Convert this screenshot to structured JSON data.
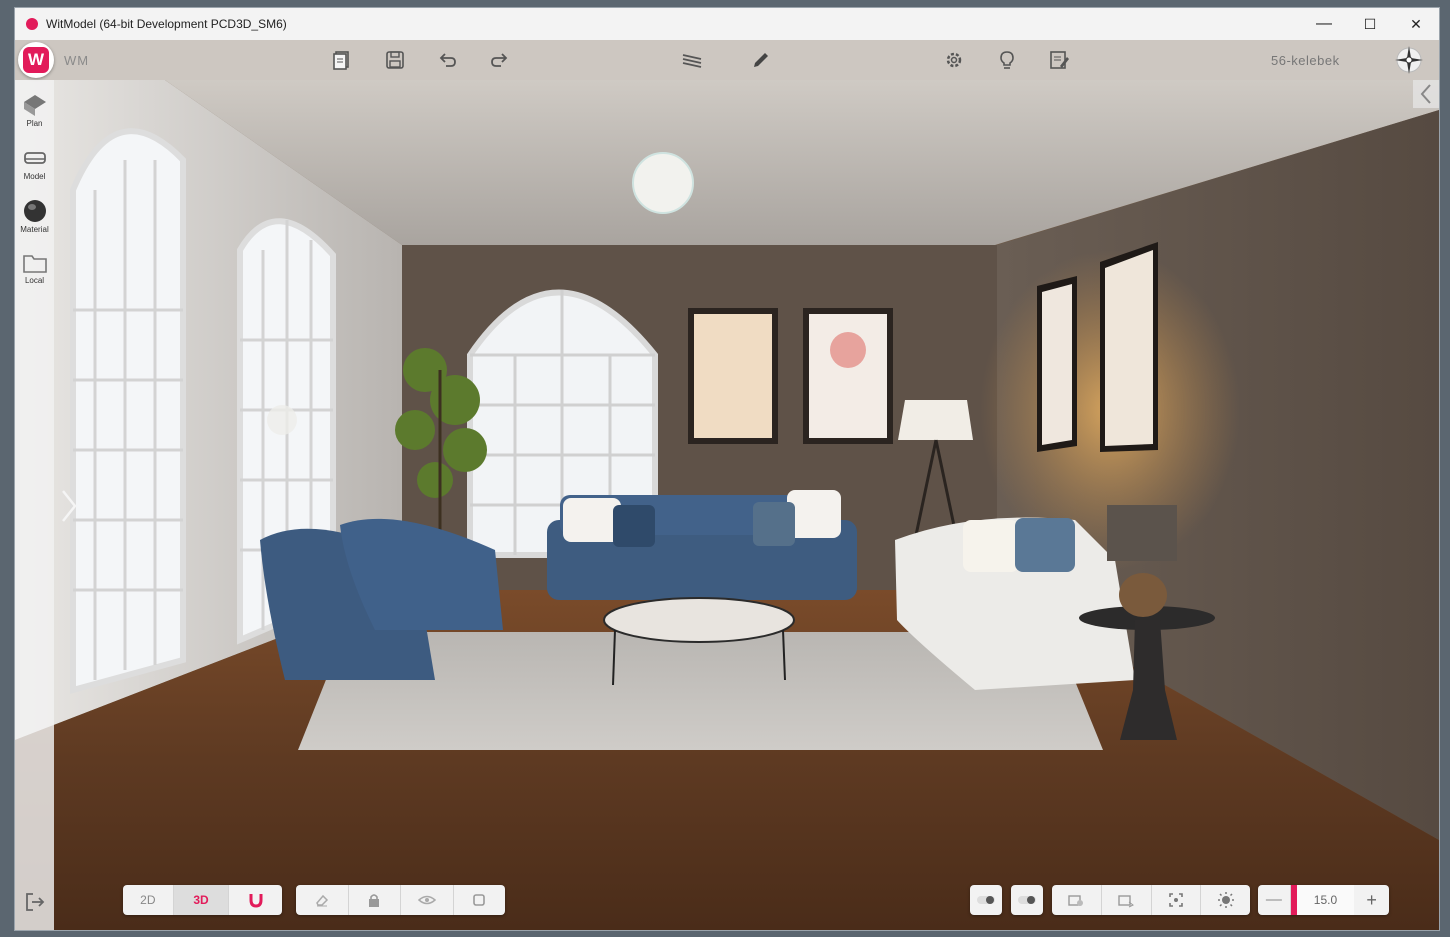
{
  "window": {
    "title": "WitModel (64-bit Development PCD3D_SM6)",
    "minimize": "—",
    "maximize": "☐",
    "close": "✕"
  },
  "toolbar": {
    "logo_letter": "W",
    "app_short": "WM",
    "project_name": "56-kelebek",
    "icons": [
      "pages-icon",
      "save-icon",
      "undo-icon",
      "redo-icon",
      "layers-icon",
      "pencil-icon",
      "settings-icon",
      "lightbulb-icon",
      "report-icon",
      "compass-icon"
    ]
  },
  "sidebar": {
    "items": [
      {
        "label": "Plan",
        "icon": "plan-icon"
      },
      {
        "label": "Model",
        "icon": "sofa-icon"
      },
      {
        "label": "Material",
        "icon": "sphere-icon"
      },
      {
        "label": "Local",
        "icon": "folder-icon"
      }
    ],
    "exit_icon": "exit-icon"
  },
  "bottom_left": {
    "view_2d": "2D",
    "view_3d": "3D",
    "active_view": "3D",
    "magnet_icon": "magnet-icon",
    "tools": [
      "eraser-icon",
      "lock-icon",
      "eye-icon",
      "square-icon"
    ]
  },
  "bottom_right": {
    "toggles": [
      "toggle-icon",
      "toggle-icon"
    ],
    "camera_tools": [
      "camera-settings-icon",
      "camera-move-icon",
      "focus-icon",
      "sun-icon"
    ],
    "zoom": {
      "minus": "—",
      "value": "15.0",
      "plus": "+"
    }
  },
  "colors": {
    "accent": "#e21b5a",
    "wall_dark": "#5f5248",
    "floor": "#6e4528",
    "sofa_blue": "#3e5c80"
  }
}
